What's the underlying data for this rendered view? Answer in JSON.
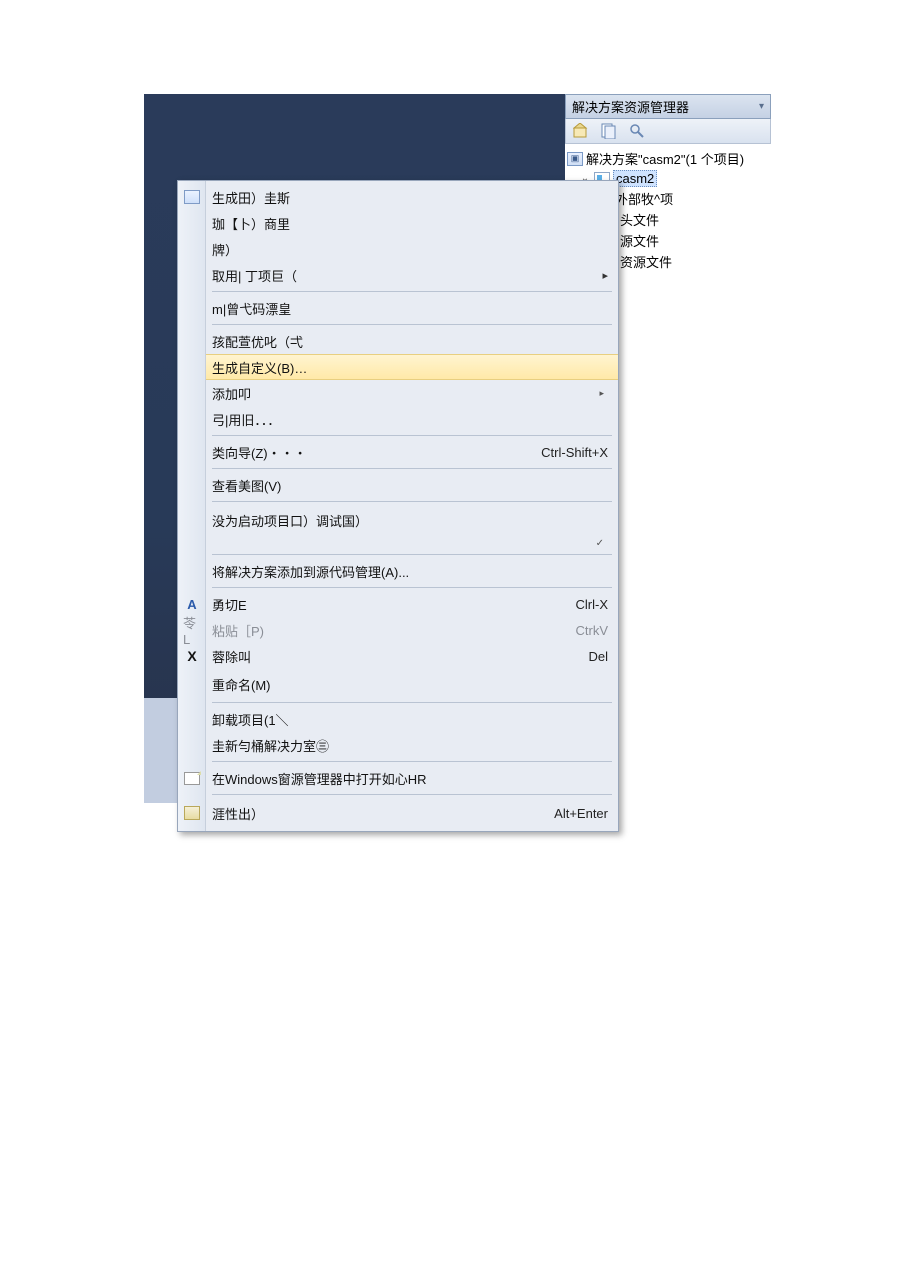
{
  "panel": {
    "title": "解决方案资源管理器",
    "solution_label": "解决方案\"casm2\"(1 个项目)",
    "project_name": "casm2",
    "folders": [
      "外部牧^项",
      "头文件",
      "源文件",
      "资源文件"
    ]
  },
  "gutter_letters": {
    "cut": "A",
    "paste": "苓L",
    "delete": "X"
  },
  "menu": {
    "build": "生成田）圭斯",
    "rebuild": "珈【卜）商里",
    "clean": "牌）",
    "project_only": "取用| 丁项巨（",
    "pgo": "m|曾弋码漂皇",
    "config_opt": "孩配萱优叱（弌",
    "build_custom": "生成自定义(B)…",
    "add": "添加叩",
    "references": "弓|用旧．．．",
    "class_wizard": "类向导(Z)・・・",
    "class_wizard_sc": "Ctrl-Shift+X",
    "view_diagram": "查看美图(V)",
    "set_startup": "没为启动项目口）调试国）",
    "add_scc": "将解决方案添加到源代码管理(A)...",
    "cut": "勇切E",
    "cut_sc": "Clrl-X",
    "paste": "粘贴［P)",
    "paste_sc": "CtrkV",
    "delete": "蓉除叫",
    "delete_sc": "Del",
    "rename": "重命名(M)",
    "unload": "卸载项目(1＼",
    "rescan": "圭新勻桶解决力室㊂",
    "open_explorer": "在Windows窗源管理器中打开如心HR",
    "properties": "涯性出）",
    "properties_sc": "Alt+Enter"
  }
}
